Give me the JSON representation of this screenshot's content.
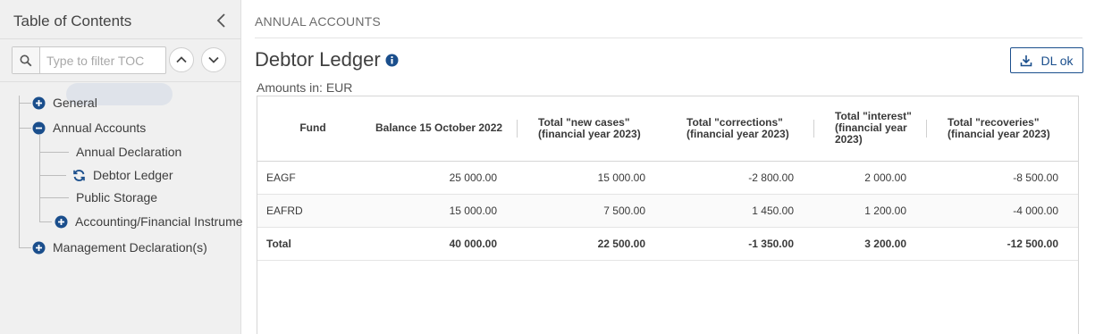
{
  "sidebar": {
    "title": "Table of Contents",
    "filter_placeholder": "Type to filter TOC",
    "items": [
      {
        "label": "General"
      },
      {
        "label": "Annual Accounts"
      },
      {
        "label": "Annual Declaration"
      },
      {
        "label": "Debtor Ledger"
      },
      {
        "label": "Public Storage"
      },
      {
        "label": "Accounting/Financial Instrume"
      },
      {
        "label": "Management Declaration(s)"
      }
    ]
  },
  "breadcrumb": "ANNUAL ACCOUNTS",
  "page": {
    "title": "Debtor Ledger",
    "download_label": "DL ok",
    "amounts_label": "Amounts in: EUR"
  },
  "table": {
    "headers": [
      "Fund",
      "Balance 15 October 2022",
      "Total \"new cases\" (financial year 2023)",
      "Total \"corrections\" (financial year 2023)",
      "Total \"interest\" (financial year 2023)",
      "Total \"recoveries\" (financial year 2023)"
    ],
    "rows": [
      [
        "EAGF",
        "25 000.00",
        "15 000.00",
        "-2 800.00",
        "2 000.00",
        "-8 500.00"
      ],
      [
        "EAFRD",
        "15 000.00",
        "7 500.00",
        "1 450.00",
        "1 200.00",
        "-4 000.00"
      ],
      [
        "Total",
        "40 000.00",
        "22 500.00",
        "-1 350.00",
        "3 200.00",
        "-12 500.00"
      ]
    ]
  },
  "colors": {
    "accent": "#1a4e8c",
    "sidebar_bg": "#f0f0f0",
    "active_item_bg": "#dfe3ea"
  },
  "icons": {
    "collapse": "chevron-left-icon",
    "search": "search-icon",
    "up": "chevron-up-icon",
    "down": "chevron-down-icon",
    "expand": "plus-circle-icon",
    "collapse_node": "minus-circle-icon",
    "refresh": "refresh-icon",
    "info": "info-icon",
    "download": "download-icon"
  }
}
